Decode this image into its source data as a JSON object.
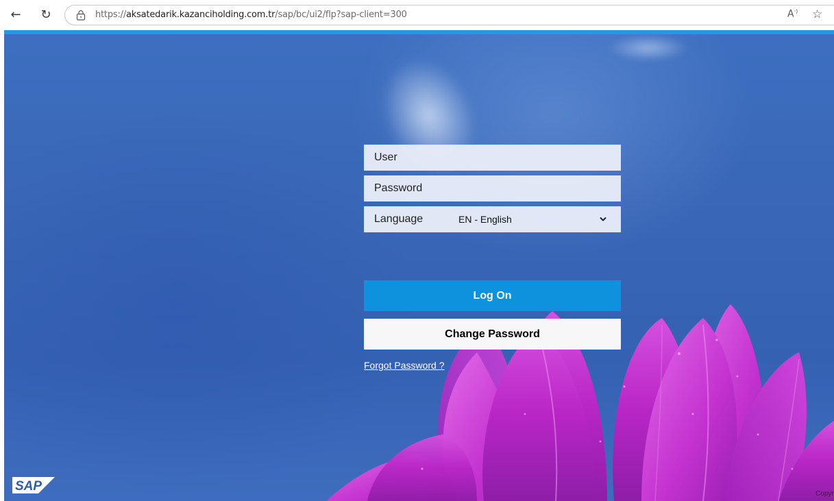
{
  "browser": {
    "url_prefix": "https://",
    "url_host": "aksatedarik.kazanciholding.com.tr",
    "url_path": "/sap/bc/ui2/flp?sap-client=300",
    "read_aloud_label": "A",
    "read_aloud_sup": "·)",
    "back_glyph": "←",
    "reload_glyph": "↻",
    "favorite_glyph": "☆"
  },
  "login": {
    "user_placeholder": "User",
    "password_placeholder": "Password",
    "language_label": "Language",
    "language_value": "EN - English",
    "logon_label": "Log On",
    "change_password_label": "Change Password",
    "forgot_password_label": "Forgot Password ?"
  },
  "footer": {
    "brand": "SAP",
    "copyright": "Copyright"
  },
  "colors": {
    "accent_blue": "#0e92dd",
    "top_line": "#1f9be6",
    "flower_magenta": "#c52fd0"
  }
}
